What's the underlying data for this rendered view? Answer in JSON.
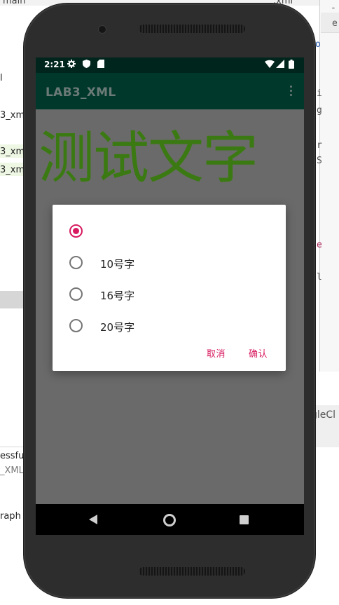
{
  "ide": {
    "top_fragment_left": "main",
    "top_fragment_right": ".xml",
    "left_lines": [
      "l",
      "3_xm",
      "3_xm",
      "3_xm"
    ],
    "build_lines": [
      "essful",
      "_XML",
      "raph"
    ],
    "right_text": "gleCl",
    "right_glyphs": [
      "-",
      "e",
      "o",
      "i",
      "g",
      "r",
      "S",
      "e",
      "l"
    ]
  },
  "status_bar": {
    "time": "2:21",
    "icons": [
      "gear-icon",
      "shield-icon",
      "sd-card-icon",
      "wifi-icon",
      "signal-icon",
      "battery-icon"
    ]
  },
  "app": {
    "title": "LAB3_XML",
    "preview_text": "测试文字"
  },
  "dialog": {
    "options": [
      {
        "label": "",
        "selected": true
      },
      {
        "label": "10号字",
        "selected": false
      },
      {
        "label": "16号字",
        "selected": false
      },
      {
        "label": "20号字",
        "selected": false
      }
    ],
    "cancel_label": "取消",
    "confirm_label": "确认"
  },
  "colors": {
    "accent": "#d81b60",
    "appbar": "#00382c",
    "statusbar": "#00251c",
    "preview_text": "#3b7a12"
  }
}
